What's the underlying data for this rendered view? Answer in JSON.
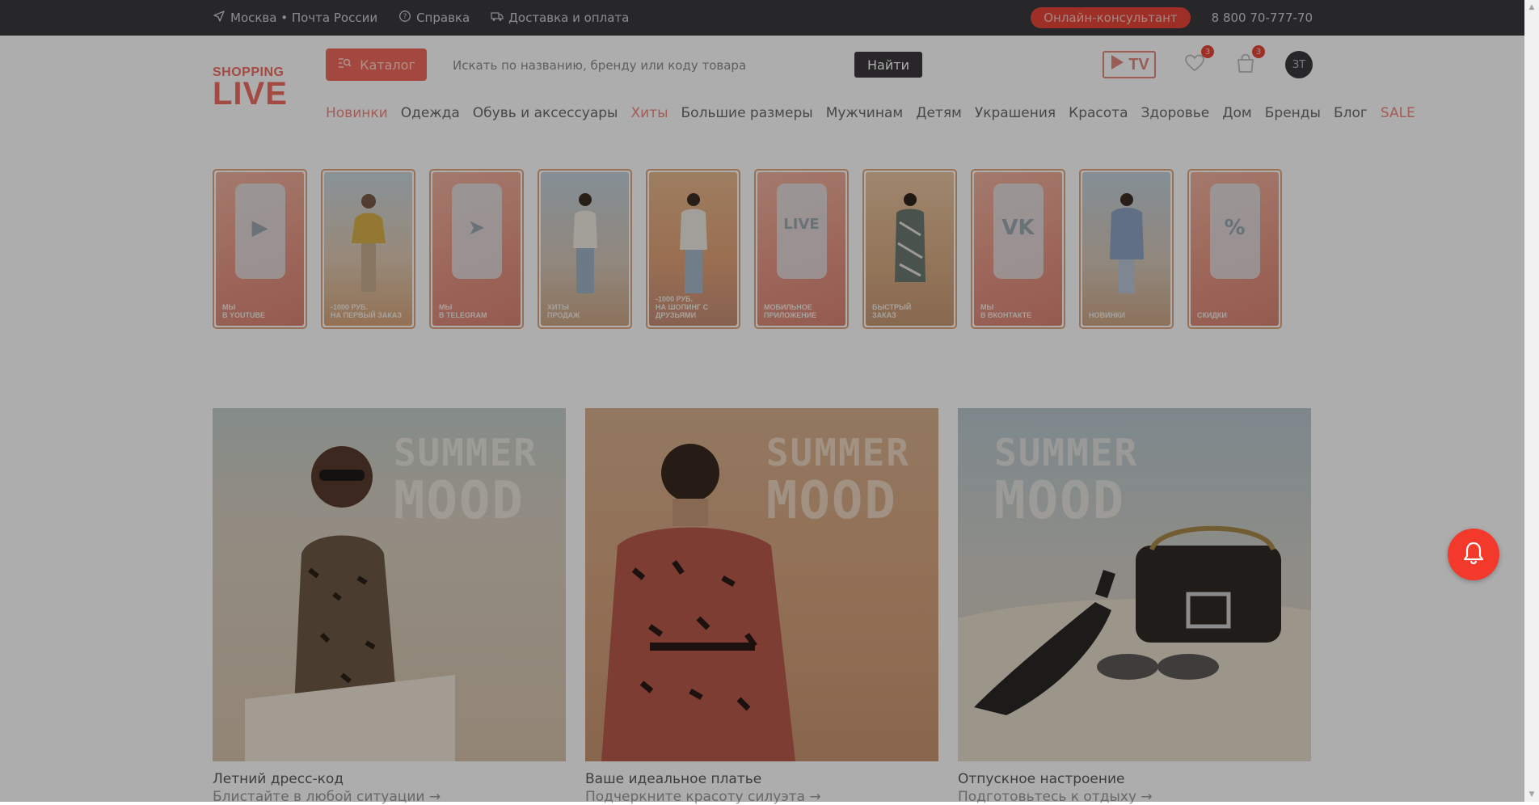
{
  "topbar": {
    "location": "Москва • Почта России",
    "help": "Справка",
    "delivery": "Доставка и оплата",
    "consultant": "Онлайн-консультант",
    "phone": "8 800 70-777-70"
  },
  "header": {
    "logo_top": "SHOPPING",
    "logo_bottom": "LIVE",
    "catalog_label": "Каталог",
    "search_placeholder": "Искать по названию, бренду или коду товара",
    "search_button": "Найти",
    "tv_label": "TV",
    "favorites_count": "3",
    "cart_count": "3",
    "avatar_initials": "ЗТ"
  },
  "nav": [
    {
      "label": "Новинки",
      "highlight": true
    },
    {
      "label": "Одежда",
      "highlight": false
    },
    {
      "label": "Обувь и аксессуары",
      "highlight": false
    },
    {
      "label": "Хиты",
      "highlight": true
    },
    {
      "label": "Большие размеры",
      "highlight": false
    },
    {
      "label": "Мужчинам",
      "highlight": false
    },
    {
      "label": "Детям",
      "highlight": false
    },
    {
      "label": "Украшения",
      "highlight": false
    },
    {
      "label": "Красота",
      "highlight": false
    },
    {
      "label": "Здоровье",
      "highlight": false
    },
    {
      "label": "Дом",
      "highlight": false
    },
    {
      "label": "Бренды",
      "highlight": false
    },
    {
      "label": "Блог",
      "highlight": false
    },
    {
      "label": "SALE",
      "highlight": true
    }
  ],
  "stories": [
    {
      "line1": "МЫ",
      "line2": "В YOUTUBE",
      "icon": "youtube-icon"
    },
    {
      "line1": "-1000 руб.",
      "line2": "НА ПЕРВЫЙ ЗАКАЗ",
      "icon": "model"
    },
    {
      "line1": "МЫ",
      "line2": "В TELEGRAM",
      "icon": "telegram-icon"
    },
    {
      "line1": "ХИТЫ",
      "line2": "ПРОДАЖ",
      "icon": "model"
    },
    {
      "line1": "-1000 руб.",
      "line2": "НА ШОПИНГ С ДРУЗЬЯМИ",
      "icon": "model"
    },
    {
      "line1": "МОБИЛЬНОЕ",
      "line2": "ПРИЛОЖЕНИЕ",
      "icon": "live-icon"
    },
    {
      "line1": "БЫСТРЫЙ",
      "line2": "ЗАКАЗ",
      "icon": "model"
    },
    {
      "line1": "МЫ",
      "line2": "В ВКОНТАКТЕ",
      "icon": "vk-icon"
    },
    {
      "line1": "",
      "line2": "НОВИНКИ",
      "icon": "model"
    },
    {
      "line1": "",
      "line2": "СКИДКИ",
      "icon": "percent-icon"
    }
  ],
  "banners": [
    {
      "overlay_1": "SUMMER",
      "overlay_2": "MOOD",
      "title": "Летний дресс-код",
      "subtitle": "Блистайте в любой ситуации →"
    },
    {
      "overlay_1": "SUMMER",
      "overlay_2": "MOOD",
      "title": "Ваше идеальное платье",
      "subtitle": "Подчеркните красоту силуэта →"
    },
    {
      "overlay_1": "SUMMER",
      "overlay_2": "MOOD",
      "title": "Отпускное настроение",
      "subtitle": "Подготовьтесь к отдыху →"
    }
  ],
  "colors": {
    "accent": "#e8463a",
    "topbar": "#3a383b",
    "overlay": "rgba(0,0,0,0.32)"
  }
}
